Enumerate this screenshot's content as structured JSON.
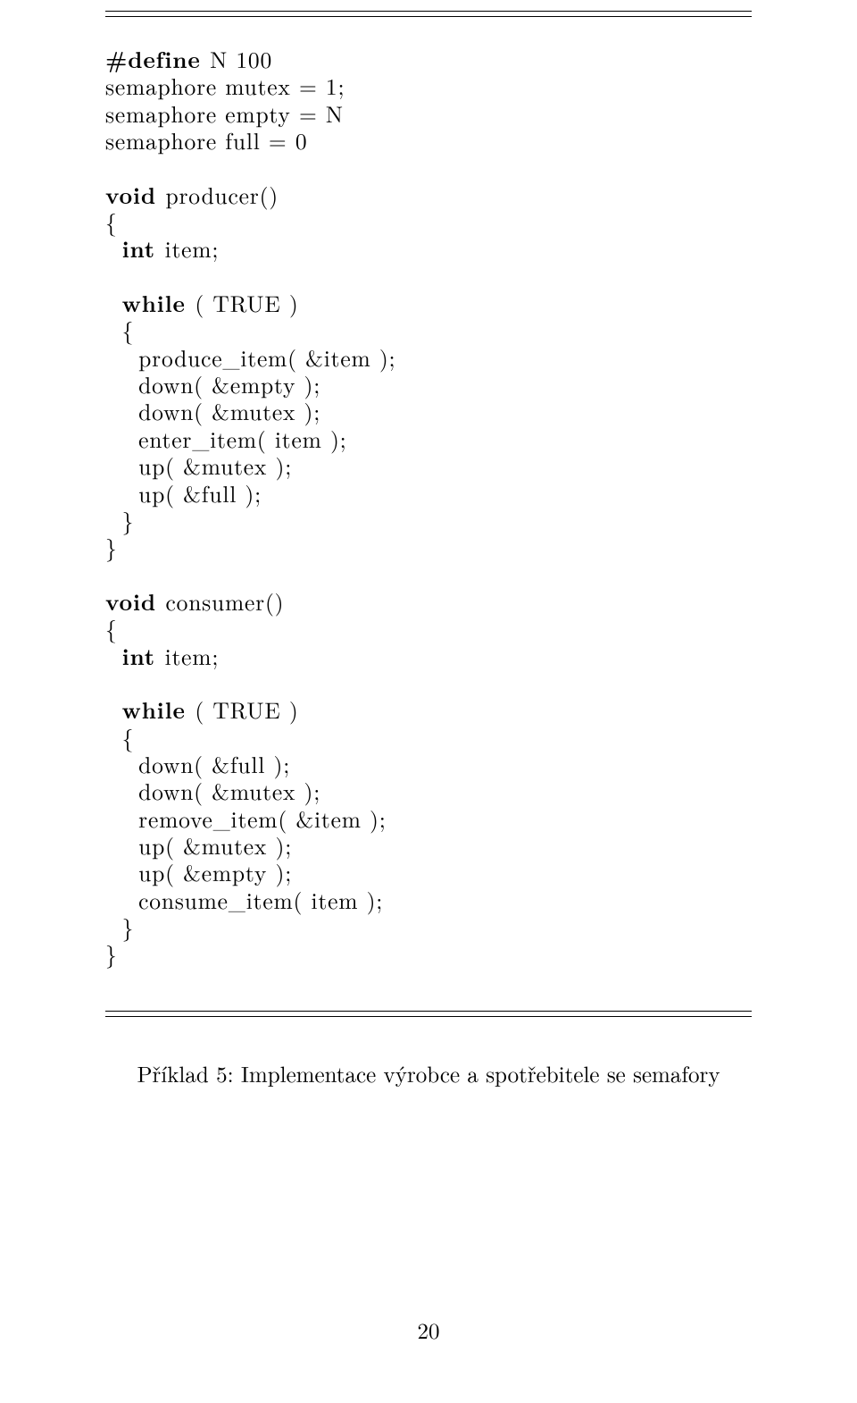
{
  "code": {
    "lines": [
      [
        {
          "t": "#define ",
          "kw": true
        },
        {
          "t": "N 100"
        }
      ],
      [
        {
          "t": "semaphore mutex = 1;"
        }
      ],
      [
        {
          "t": "semaphore empty = N"
        }
      ],
      [
        {
          "t": "semaphore full = 0"
        }
      ],
      [
        {
          "t": ""
        }
      ],
      [
        {
          "t": "void ",
          "kw": true
        },
        {
          "t": "producer()"
        }
      ],
      [
        {
          "t": "{"
        }
      ],
      [
        {
          "t": "  "
        },
        {
          "t": "int ",
          "kw": true
        },
        {
          "t": "item;"
        }
      ],
      [
        {
          "t": ""
        }
      ],
      [
        {
          "t": "  "
        },
        {
          "t": "while ",
          "kw": true
        },
        {
          "t": "( TRUE )"
        }
      ],
      [
        {
          "t": "  {"
        }
      ],
      [
        {
          "t": "    produce_item( &item );"
        }
      ],
      [
        {
          "t": "    down( &empty );"
        }
      ],
      [
        {
          "t": "    down( &mutex );"
        }
      ],
      [
        {
          "t": "    enter_item( item );"
        }
      ],
      [
        {
          "t": "    up( &mutex );"
        }
      ],
      [
        {
          "t": "    up( &full );"
        }
      ],
      [
        {
          "t": "  }"
        }
      ],
      [
        {
          "t": "}"
        }
      ],
      [
        {
          "t": ""
        }
      ],
      [
        {
          "t": "void ",
          "kw": true
        },
        {
          "t": "consumer()"
        }
      ],
      [
        {
          "t": "{"
        }
      ],
      [
        {
          "t": "  "
        },
        {
          "t": "int ",
          "kw": true
        },
        {
          "t": "item;"
        }
      ],
      [
        {
          "t": ""
        }
      ],
      [
        {
          "t": "  "
        },
        {
          "t": "while ",
          "kw": true
        },
        {
          "t": "( TRUE )"
        }
      ],
      [
        {
          "t": "  {"
        }
      ],
      [
        {
          "t": "    down( &full );"
        }
      ],
      [
        {
          "t": "    down( &mutex );"
        }
      ],
      [
        {
          "t": "    remove_item( &item );"
        }
      ],
      [
        {
          "t": "    up( &mutex );"
        }
      ],
      [
        {
          "t": "    up( &empty );"
        }
      ],
      [
        {
          "t": "    consume_item( item );"
        }
      ],
      [
        {
          "t": "  }"
        }
      ],
      [
        {
          "t": "}"
        }
      ]
    ]
  },
  "caption": "Příklad 5: Implementace výrobce a spotřebitele se semafory",
  "page_number": "20"
}
